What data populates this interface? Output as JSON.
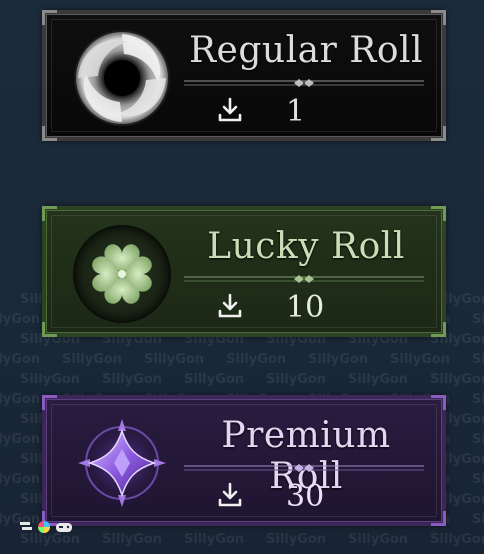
{
  "watermark": {
    "text": "SillyGon",
    "rows": [
      0,
      1,
      2,
      3,
      4,
      5,
      6,
      7,
      8,
      9,
      10,
      11,
      12
    ]
  },
  "cards": [
    {
      "id": "regular",
      "title": "Regular Roll",
      "count": "1",
      "theme_color": "#d8d8d8",
      "icon": "swirl-portal-icon"
    },
    {
      "id": "lucky",
      "title": "Lucky Roll",
      "count": "10",
      "theme_color": "#8fb077",
      "icon": "four-leaf-clover-icon"
    },
    {
      "id": "premium",
      "title": "Premium Roll",
      "count": "30",
      "theme_color": "#9a66e0",
      "icon": "purple-crystal-icon"
    }
  ],
  "count_icon": "download-icon"
}
